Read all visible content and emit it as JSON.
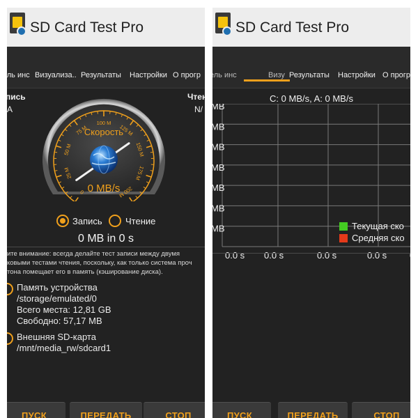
{
  "app": {
    "title": "SD Card Test Pro",
    "accent_color": "#f0a01c",
    "icon": "sd-card-app-icon"
  },
  "left": {
    "tabs": [
      {
        "label": "ель инс"
      },
      {
        "label": "Визуализа.."
      },
      {
        "label": "Результаты"
      },
      {
        "label": "Настройки"
      },
      {
        "label": "О прогр"
      }
    ],
    "write_stat": {
      "label": "пись",
      "value": "A"
    },
    "read_stat": {
      "label": "Чтени",
      "value": "N/"
    },
    "gauge": {
      "title": "Скорость",
      "readout": "0 MB/s",
      "value": 0,
      "max": 200,
      "ticks": [
        "0",
        "25 M",
        "50 M",
        "75 M",
        "100 M",
        "125 M",
        "150 M",
        "175 M",
        "200 M"
      ],
      "center_icon": "globe-icon"
    },
    "modes": [
      {
        "label": "Запись",
        "selected": true
      },
      {
        "label": "Чтение",
        "selected": false
      }
    ],
    "summary": "0 MB in 0 s",
    "note_lines": [
      "ите внимание: всегда делайте тест записи между двумя",
      "ковыми тестами чтения, поскольку, как только система проч",
      "тона помещает его в память (кэширование диска)."
    ],
    "storages": [
      {
        "lines": [
          "Память устройства",
          "/storage/emulated/0",
          "Всего места: 12,81 GB",
          "Свободно: 57,17 MB"
        ],
        "selected": false
      },
      {
        "lines": [
          "Внешняя SD-карта",
          "/mnt/media_rw/sdcard1"
        ],
        "selected": false
      }
    ],
    "buttons": {
      "start": "ПУСК",
      "share": "ПЕРЕДАТЬ",
      "stop": "СТОП"
    }
  },
  "right": {
    "tabs": [
      {
        "label": "ель инс",
        "selected": false
      },
      {
        "label": "Визу",
        "selected": true
      },
      {
        "label": "Результаты",
        "selected": false
      },
      {
        "label": "Настройки",
        "selected": false
      },
      {
        "label": "О прогр",
        "selected": false
      }
    ],
    "chart_title": "C: 0 MB/s, A: 0 MB/s",
    "chart_data": {
      "type": "line",
      "title": "C: 0 MB/s, A: 0 MB/s",
      "y_tick_labels": [
        "MB",
        "MB",
        "MB",
        "MB",
        "MB",
        "MB",
        "MB"
      ],
      "x_tick_labels": [
        "0.0 s",
        "0.0 s",
        "0.0 s",
        "0.0 s",
        "0.0 s"
      ],
      "series": [
        {
          "name": "Текущая ско",
          "color": "#44cc22",
          "values": []
        },
        {
          "name": "Средняя ско",
          "color": "#e53a1a",
          "values": []
        }
      ],
      "grid": true,
      "legend": "bottom-right"
    },
    "buttons": {
      "start": "ПУСК",
      "share": "ПЕРЕДАТЬ",
      "stop": "СТОП"
    }
  }
}
